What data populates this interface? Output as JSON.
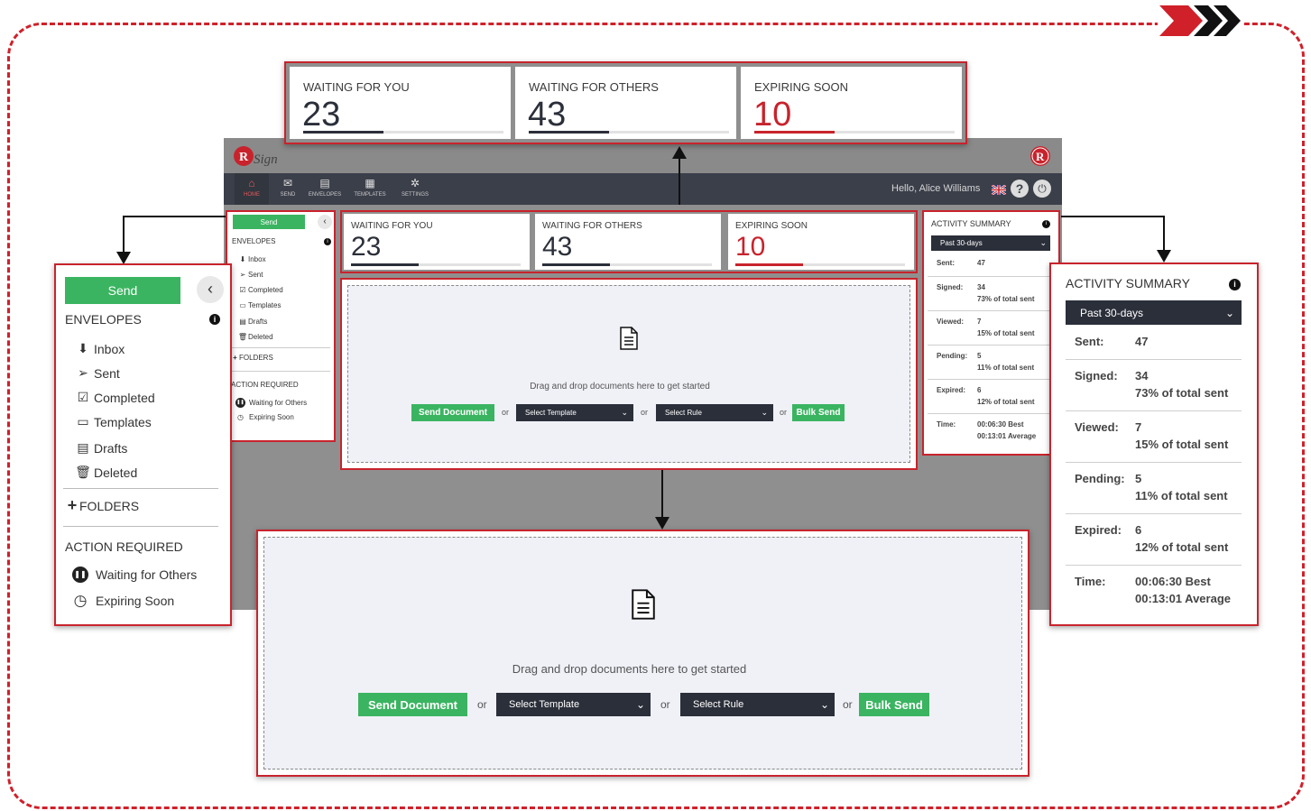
{
  "app": {
    "brand": "RSign",
    "nav": [
      {
        "label": "HOME",
        "icon": "home-icon"
      },
      {
        "label": "SEND",
        "icon": "envelope-icon"
      },
      {
        "label": "ENVELOPES",
        "icon": "envelopes-icon"
      },
      {
        "label": "TEMPLATES",
        "icon": "templates-icon"
      },
      {
        "label": "SETTINGS",
        "icon": "gear-icon"
      }
    ],
    "greeting": "Hello, Alice Williams"
  },
  "stats": [
    {
      "label": "WAITING FOR YOU",
      "value": "23",
      "progress": 0.4
    },
    {
      "label": "WAITING FOR OTHERS",
      "value": "43",
      "progress": 0.4
    },
    {
      "label": "EXPIRING SOON",
      "value": "10",
      "progress": 0.4
    }
  ],
  "sidebar": {
    "send_label": "Send",
    "envelopes_title": "ENVELOPES",
    "items": [
      {
        "label": "Inbox",
        "icon": "inbox-icon"
      },
      {
        "label": "Sent",
        "icon": "paper-plane-icon"
      },
      {
        "label": "Completed",
        "icon": "checkbox-icon"
      },
      {
        "label": "Templates",
        "icon": "template-icon"
      },
      {
        "label": "Drafts",
        "icon": "drafts-icon"
      },
      {
        "label": "Deleted",
        "icon": "trash-icon"
      }
    ],
    "folders_label": "FOLDERS",
    "action_title": "ACTION REQUIRED",
    "actions": [
      {
        "label": "Waiting for Others",
        "icon": "pause-icon"
      },
      {
        "label": "Expiring Soon",
        "icon": "clock-icon"
      }
    ]
  },
  "dropzone": {
    "hint": "Drag and drop documents here to get started",
    "send_document": "Send Document",
    "or": "or",
    "select_template": "Select Template",
    "select_rule": "Select Rule",
    "bulk_send": "Bulk Send"
  },
  "activity": {
    "title": "ACTIVITY SUMMARY",
    "period": "Past 30-days",
    "rows": [
      {
        "key": "Sent:",
        "value": "47",
        "sub": ""
      },
      {
        "key": "Signed:",
        "value": "34",
        "sub": "73% of total sent"
      },
      {
        "key": "Viewed:",
        "value": "7",
        "sub": "15% of total sent"
      },
      {
        "key": "Pending:",
        "value": "5",
        "sub": "11% of total sent"
      },
      {
        "key": "Expired:",
        "value": "6",
        "sub": "12% of total sent"
      },
      {
        "key": "Time:",
        "value": "00:06:30 Best",
        "sub": "00:13:01 Average"
      }
    ]
  },
  "colors": {
    "brand_red": "#c8232c",
    "green": "#3bb461",
    "dark": "#2b2f3a"
  }
}
